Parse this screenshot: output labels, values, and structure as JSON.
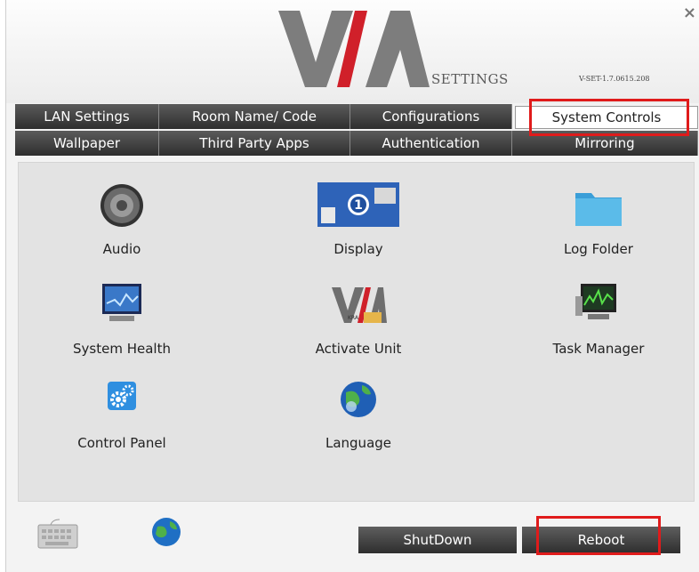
{
  "header": {
    "logo_text": "VIA",
    "settings_label": "SETTINGS",
    "version": "V-SET-1.7.0615.208",
    "close_glyph": "×"
  },
  "tabs": [
    {
      "label": "LAN Settings",
      "active": false
    },
    {
      "label": "Room Name/ Code",
      "active": false
    },
    {
      "label": "Configurations",
      "active": false
    },
    {
      "label": "System Controls",
      "active": true
    },
    {
      "label": "Wallpaper",
      "active": false
    },
    {
      "label": "Third Party Apps",
      "active": false
    },
    {
      "label": "Authentication",
      "active": false
    },
    {
      "label": "Mirroring",
      "active": false
    }
  ],
  "items": [
    {
      "label": "Audio",
      "icon": "speaker-icon"
    },
    {
      "label": "Display",
      "icon": "display-icon"
    },
    {
      "label": "Log Folder",
      "icon": "folder-icon"
    },
    {
      "label": "System Health",
      "icon": "monitor-icon"
    },
    {
      "label": "Activate Unit",
      "icon": "via-logo-icon"
    },
    {
      "label": "Task Manager",
      "icon": "task-monitor-icon"
    },
    {
      "label": "Control Panel",
      "icon": "gears-icon"
    },
    {
      "label": "Language",
      "icon": "globe-icon"
    }
  ],
  "footer": {
    "keyboard_icon": "keyboard-icon",
    "globe_icon": "globe-icon",
    "shutdown_label": "ShutDown",
    "reboot_label": "Reboot"
  },
  "highlight_color": "#e01b1b",
  "display_badge": "1",
  "via_badge_text": "KRA"
}
